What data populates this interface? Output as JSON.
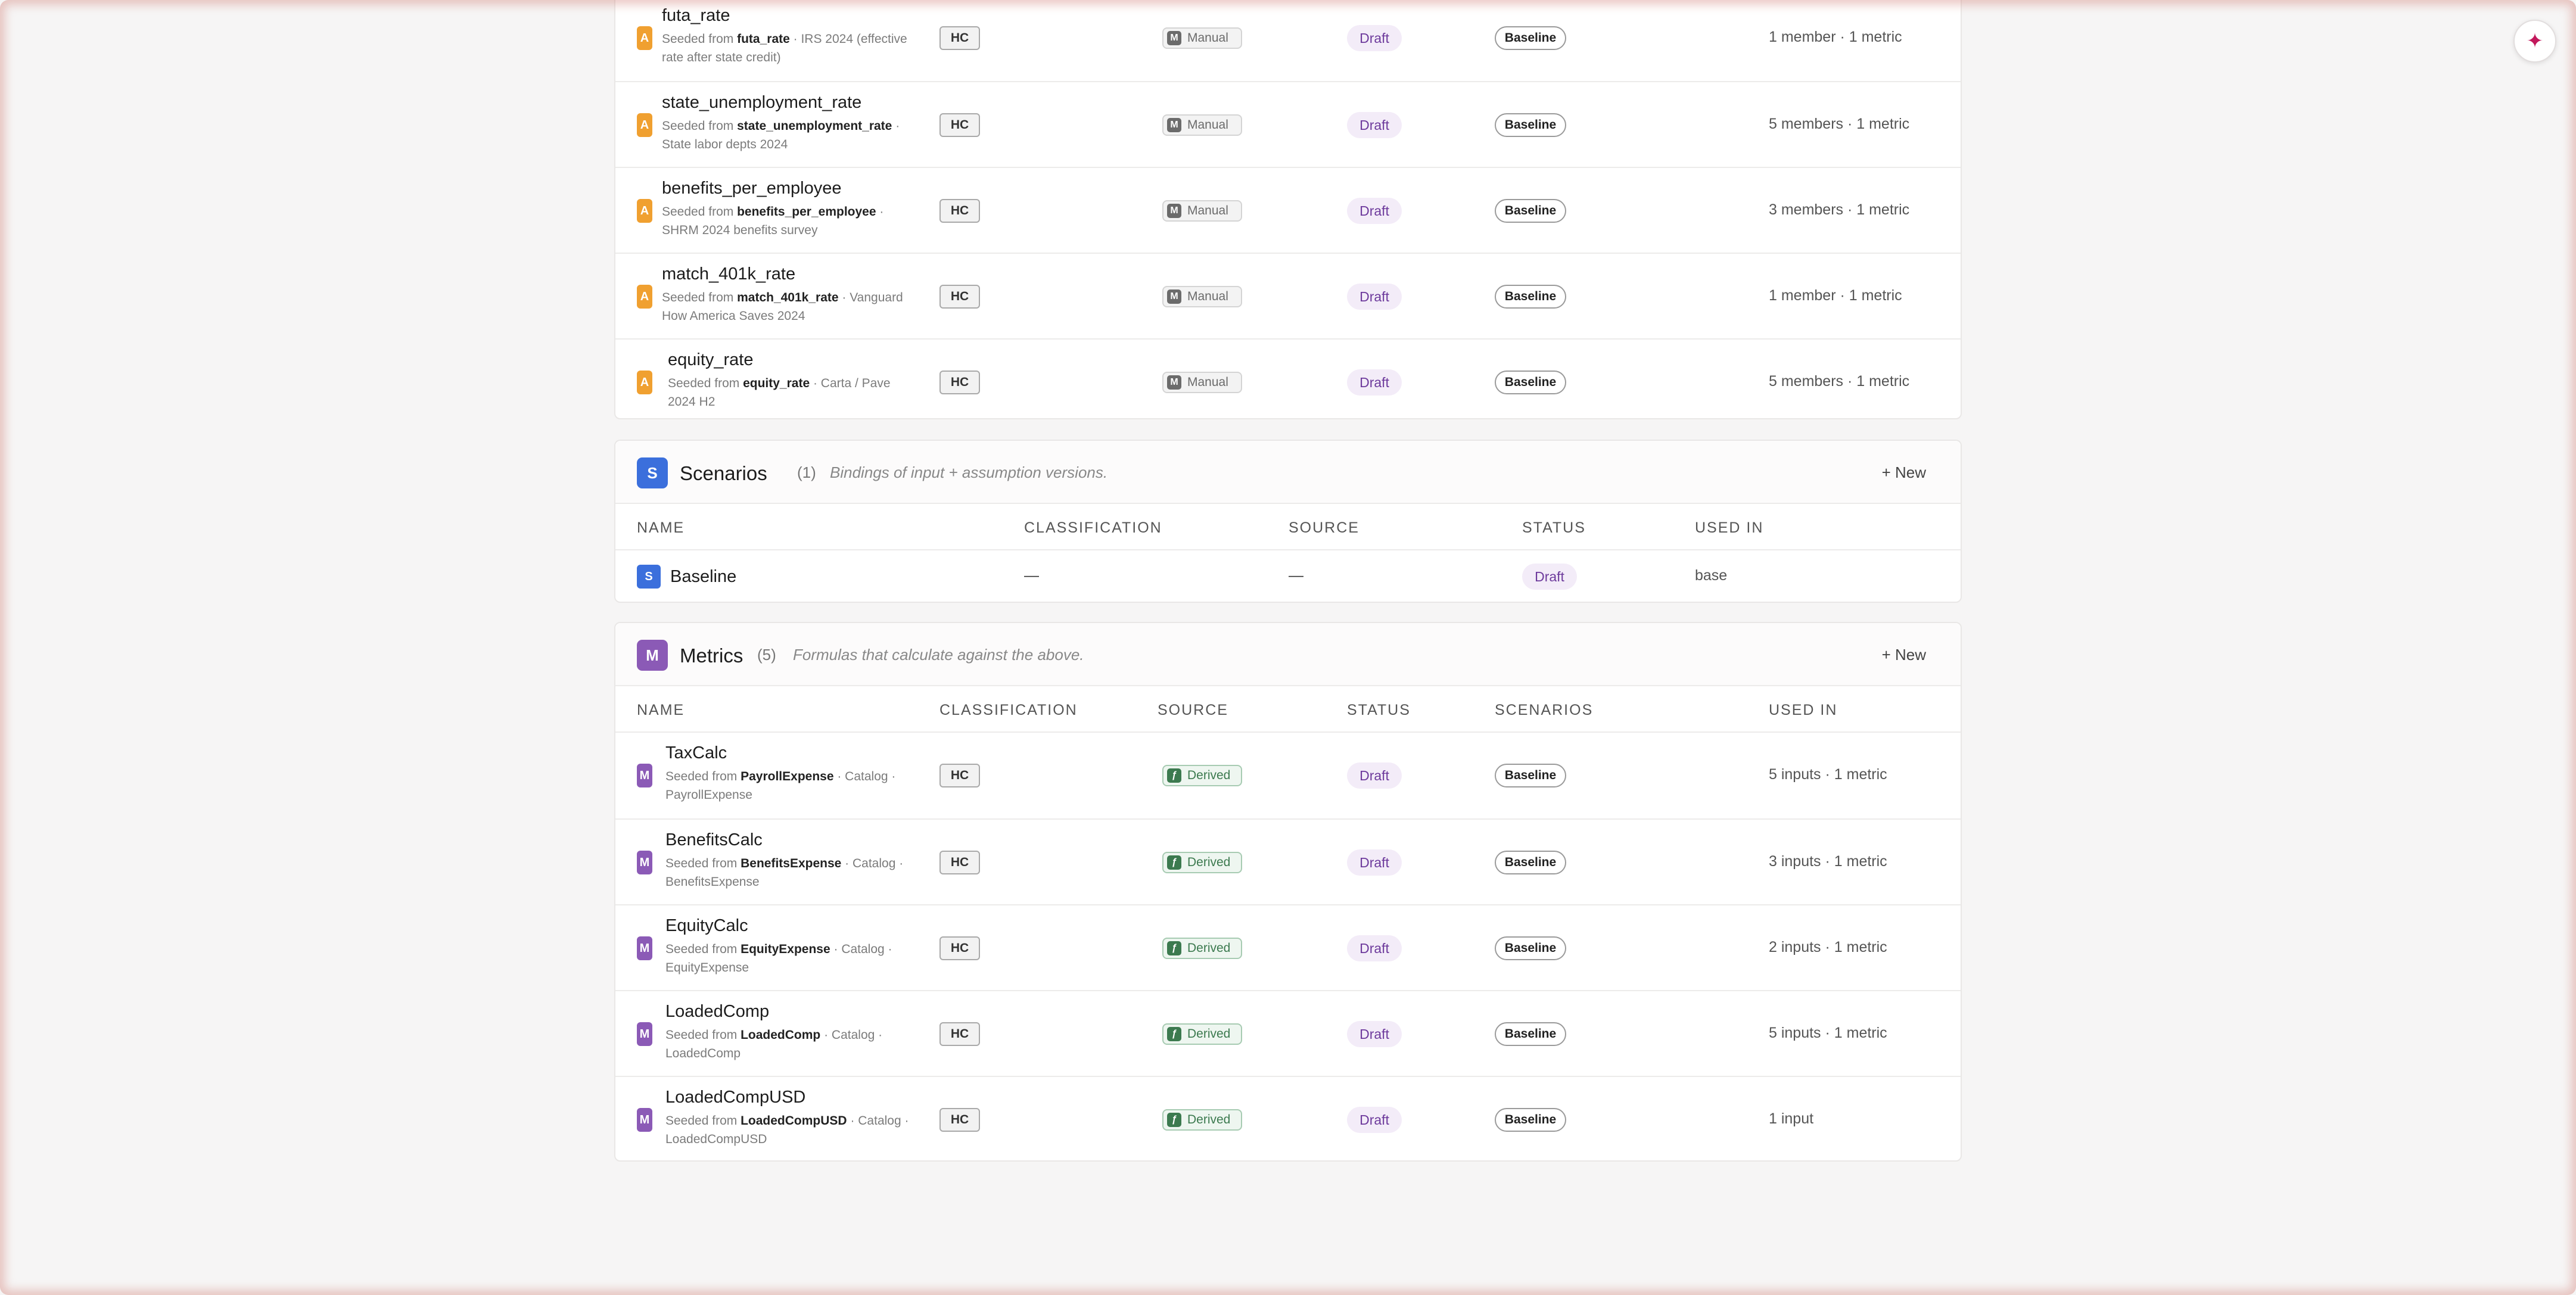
{
  "assumptions": {
    "rows": [
      {
        "icon": "A",
        "name": "futa_rate",
        "seeded_prefix": "Seeded from",
        "seeded_key": "futa_rate",
        "seeded_line1": "· IRS 2024 (effective",
        "seeded_line2": "rate after state credit)",
        "classification": "HC",
        "source": "Manual",
        "status": "Draft",
        "scenario": "Baseline",
        "used_in": "1 member · 1 metric"
      },
      {
        "icon": "A",
        "name": "state_unemployment_rate",
        "seeded_prefix": "Seeded from",
        "seeded_key": "state_unemployment_rate",
        "seeded_line1": "·",
        "seeded_line2": "State labor depts 2024",
        "classification": "HC",
        "source": "Manual",
        "status": "Draft",
        "scenario": "Baseline",
        "used_in": "5 members · 1 metric"
      },
      {
        "icon": "A",
        "name": "benefits_per_employee",
        "seeded_prefix": "Seeded from",
        "seeded_key": "benefits_per_employee",
        "seeded_line1": "·",
        "seeded_line2": "SHRM 2024 benefits survey",
        "classification": "HC",
        "source": "Manual",
        "status": "Draft",
        "scenario": "Baseline",
        "used_in": "3 members · 1 metric"
      },
      {
        "icon": "A",
        "name": "match_401k_rate",
        "seeded_prefix": "Seeded from",
        "seeded_key": "match_401k_rate",
        "seeded_line1": "· Vanguard",
        "seeded_line2": "How America Saves 2024",
        "classification": "HC",
        "source": "Manual",
        "status": "Draft",
        "scenario": "Baseline",
        "used_in": "1 member · 1 metric"
      },
      {
        "icon": "A",
        "name": "equity_rate",
        "seeded_prefix": "Seeded from",
        "seeded_key": "equity_rate",
        "seeded_line1": "· Carta / Pave",
        "seeded_line2": "2024 H2",
        "classification": "HC",
        "source": "Manual",
        "status": "Draft",
        "scenario": "Baseline",
        "used_in": "5 members · 1 metric"
      }
    ]
  },
  "scenarios": {
    "icon": "S",
    "title": "Scenarios",
    "count": "(1)",
    "description": "Bindings of input + assumption versions.",
    "new_label": "+ New",
    "columns": [
      "NAME",
      "CLASSIFICATION",
      "SOURCE",
      "STATUS",
      "USED IN"
    ],
    "rows": [
      {
        "icon": "S",
        "name": "Baseline",
        "classification": "—",
        "source": "—",
        "status": "Draft",
        "used_in": "base"
      }
    ]
  },
  "metrics": {
    "icon": "M",
    "title": "Metrics",
    "count": "(5)",
    "description": "Formulas that calculate against the above.",
    "new_label": "+ New",
    "columns": [
      "NAME",
      "CLASSIFICATION",
      "SOURCE",
      "STATUS",
      "SCENARIOS",
      "USED IN"
    ],
    "rows": [
      {
        "icon": "M",
        "name": "TaxCalc",
        "seeded_prefix": "Seeded from",
        "seeded_key": "PayrollExpense",
        "seeded_line1": "· Catalog ·",
        "seeded_line2": "PayrollExpense",
        "classification": "HC",
        "source": "Derived",
        "status": "Draft",
        "scenario": "Baseline",
        "used_in": "5 inputs · 1 metric"
      },
      {
        "icon": "M",
        "name": "BenefitsCalc",
        "seeded_prefix": "Seeded from",
        "seeded_key": "BenefitsExpense",
        "seeded_line1": "· Catalog ·",
        "seeded_line2": "BenefitsExpense",
        "classification": "HC",
        "source": "Derived",
        "status": "Draft",
        "scenario": "Baseline",
        "used_in": "3 inputs · 1 metric"
      },
      {
        "icon": "M",
        "name": "EquityCalc",
        "seeded_prefix": "Seeded from",
        "seeded_key": "EquityExpense",
        "seeded_line1": "· Catalog ·",
        "seeded_line2": "EquityExpense",
        "classification": "HC",
        "source": "Derived",
        "status": "Draft",
        "scenario": "Baseline",
        "used_in": "2 inputs · 1 metric"
      },
      {
        "icon": "M",
        "name": "LoadedComp",
        "seeded_prefix": "Seeded from",
        "seeded_key": "LoadedComp",
        "seeded_line1": "· Catalog ·",
        "seeded_line2": "LoadedComp",
        "classification": "HC",
        "source": "Derived",
        "status": "Draft",
        "scenario": "Baseline",
        "used_in": "5 inputs · 1 metric"
      },
      {
        "icon": "M",
        "name": "LoadedCompUSD",
        "seeded_prefix": "Seeded from",
        "seeded_key": "LoadedCompUSD",
        "seeded_line1": "· Catalog ·",
        "seeded_line2": "LoadedCompUSD",
        "classification": "HC",
        "source": "Derived",
        "status": "Draft",
        "scenario": "Baseline",
        "used_in": "1 input"
      }
    ]
  },
  "source_glyphs": {
    "Manual": "M",
    "Derived": "ƒ"
  },
  "fab_icon": "sparkle-icon",
  "colors": {
    "assumption_icon": "#f0a030",
    "metric_icon": "#8b5ab6",
    "scenario_icon": "#3b6fdc",
    "draft_text": "#6d3a9c",
    "derived_text": "#3c7a4f"
  }
}
